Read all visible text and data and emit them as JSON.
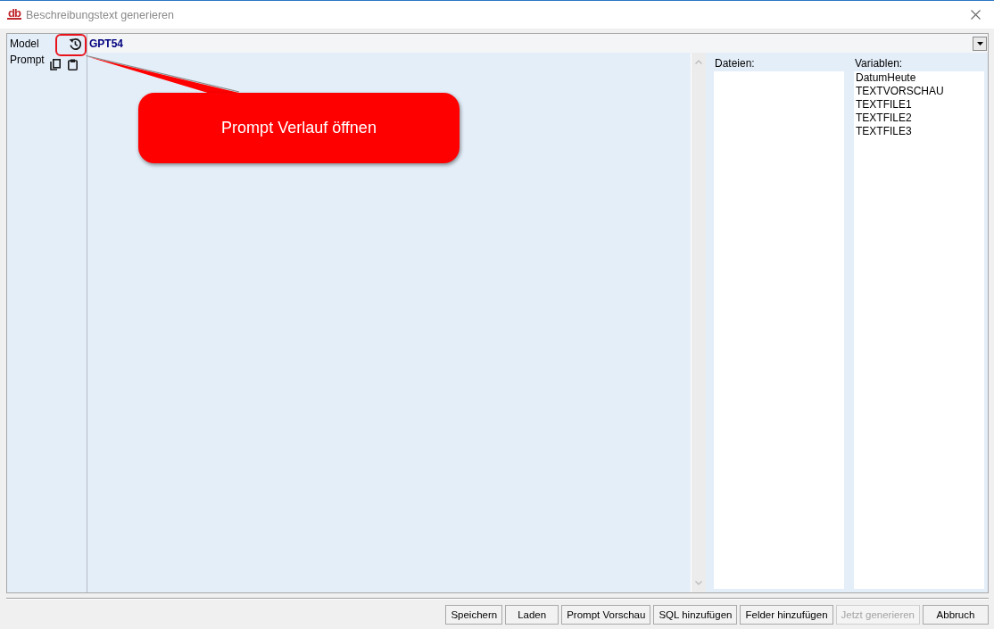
{
  "window": {
    "logo": "db",
    "title": "Beschreibungstext generieren"
  },
  "model": {
    "label": "Model",
    "value": "GPT54"
  },
  "prompt": {
    "label": "Prompt"
  },
  "files": {
    "label": "Dateien:"
  },
  "variables": {
    "label": "Variablen:",
    "items": [
      "DatumHeute",
      "TEXTVORSCHAU",
      "TEXTFILE1",
      "TEXTFILE2",
      "TEXTFILE3"
    ]
  },
  "buttons": [
    {
      "label": "Speichern",
      "disabled": false
    },
    {
      "label": "Laden",
      "disabled": false
    },
    {
      "label": "Prompt Vorschau",
      "disabled": false
    },
    {
      "label": "SQL hinzufügen",
      "disabled": false
    },
    {
      "label": "Felder hinzufügen",
      "disabled": false
    },
    {
      "label": "Jetzt generieren",
      "disabled": true
    },
    {
      "label": "Abbruch",
      "disabled": false
    }
  ],
  "callout": {
    "text": "Prompt Verlauf öffnen"
  }
}
